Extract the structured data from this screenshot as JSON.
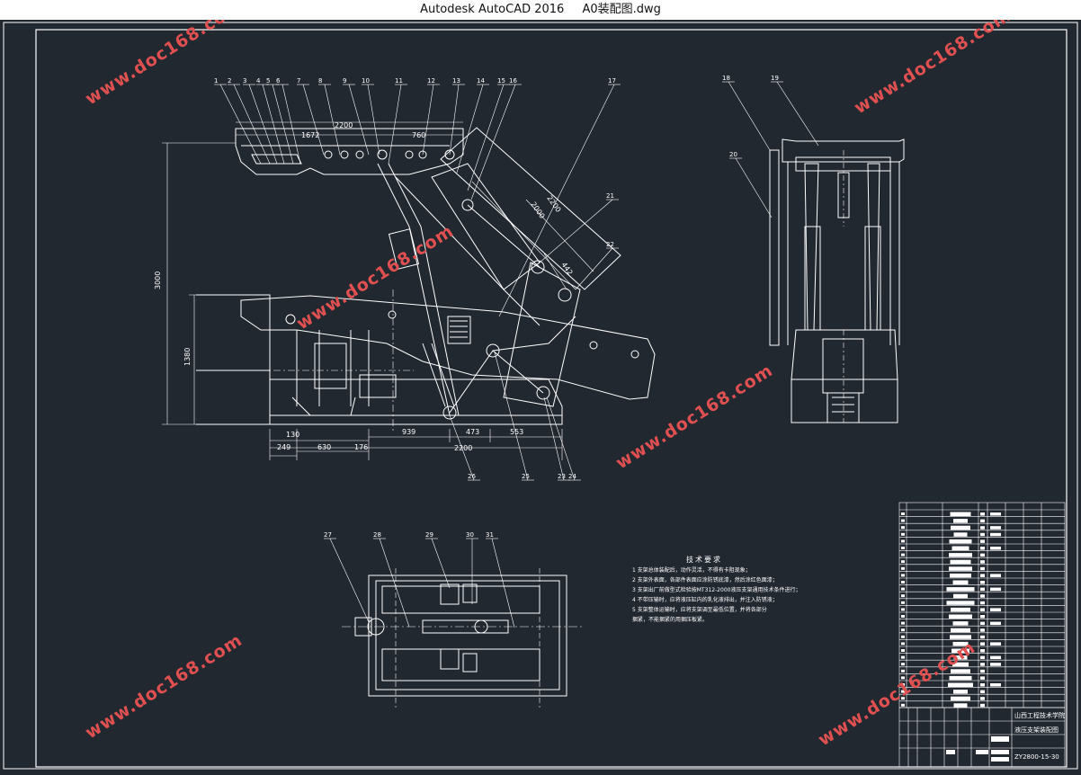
{
  "window": {
    "app_name": "Autodesk AutoCAD 2016",
    "file_name": "A0装配图.dwg"
  },
  "colors": {
    "background": "#212830",
    "lines": "#ffffff",
    "watermark": "#e05050",
    "titlebar": "#ffffff"
  },
  "watermark": "www.doc168.com",
  "side_view_callouts": [
    "1",
    "2",
    "3",
    "4",
    "5",
    "6",
    "7",
    "8",
    "9",
    "10",
    "11",
    "12",
    "13",
    "14",
    "15",
    "16",
    "17",
    "21",
    "22",
    "23",
    "24",
    "25",
    "26"
  ],
  "front_view_callouts": [
    "18",
    "19",
    "20"
  ],
  "plan_view_callouts": [
    "27",
    "28",
    "29",
    "30",
    "31"
  ],
  "dimensions": {
    "overall_top": "2200",
    "top_left": "1672",
    "top_right": "760",
    "height_total": "3000",
    "height_lower": "1380",
    "bottom_1": "939",
    "bottom_2": "473",
    "bottom_3": "553",
    "bottom_4": "249",
    "bottom_5": "630",
    "bottom_6": "176",
    "bottom_7": "130",
    "bottom_total": "2200",
    "beam_1": "2200",
    "beam_2": "2000",
    "beam_3": "442"
  },
  "tech_requirements": {
    "title": "技术要求",
    "items": [
      "1 支架总体装配后，动作灵活，不得有卡阻现象；",
      "2 支架外表面，各部件表面应涂防锈底漆，然后涂红色面漆；",
      "3 支架出厂前做型式检验按MT312-2000液压支架通用技术条件进行；",
      "4 不带压输时，应将液压缸内的乳化液排出，并注入防锈液；",
      "5 支架整体运输时，应将支架调至最低位置，并将各部分",
      "   捆紧，不能捆紧的用捆压板紧。"
    ]
  },
  "title_block": {
    "school": "山西工程技术学院",
    "drawing_name": "液压支架装配图",
    "drawing_number": "ZY2800-15-30"
  }
}
